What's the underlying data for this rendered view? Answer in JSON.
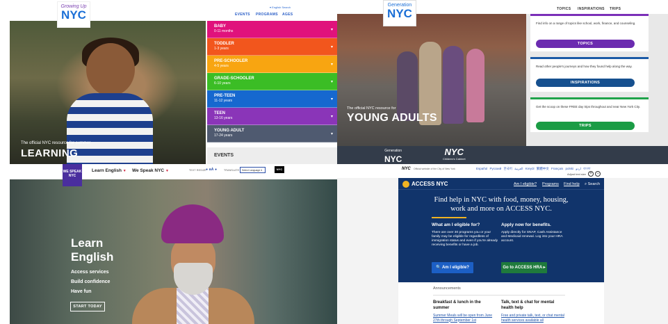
{
  "q1": {
    "logo_small": "Growing Up",
    "logo_big": "NYC",
    "lang_links": "▾ English   Search",
    "nav": [
      "EVENTS",
      "PROGRAMS",
      "AGES"
    ],
    "caption_small": "The official NYC resource for summer",
    "caption_big": "LEARNING",
    "menu": [
      {
        "name": "BABY",
        "sub": "0-11 months",
        "color": "#e0127c"
      },
      {
        "name": "TODDLER",
        "sub": "1-3 years",
        "color": "#f2561d"
      },
      {
        "name": "PRE-SCHOOLER",
        "sub": "4-5 years",
        "color": "#f8a511"
      },
      {
        "name": "GRADE-SCHOOLER",
        "sub": "6-10 years",
        "color": "#3bbd25"
      },
      {
        "name": "PRE-TEEN",
        "sub": "11-12 years",
        "color": "#1668cf"
      },
      {
        "name": "TEEN",
        "sub": "13-16 years",
        "color": "#8a35b8"
      },
      {
        "name": "YOUNG ADULT",
        "sub": "17-24 years",
        "color": "#4f5a70"
      }
    ],
    "events_label": "EVENTS"
  },
  "q2": {
    "logo_small": "Generation",
    "logo_big": "NYC",
    "nav": [
      "TOPICS",
      "INSPIRATIONS",
      "TRIPS"
    ],
    "caption_small": "The official NYC resource for",
    "caption_big": "YOUNG ADULTS",
    "cards": [
      {
        "text": "Find info on a range of topics like school, work, finance, and counseling.",
        "button": "TOPICS",
        "accent": "#7b2fb8",
        "btn_color": "#6b2bb0"
      },
      {
        "text": "Read other people's journeys and how they found help along the way.",
        "button": "INSPIRATIONS",
        "accent": "#1b5aa6",
        "btn_color": "#16508f"
      },
      {
        "text": "Get the scoop on these FREE day trips throughout and near New York City.",
        "button": "TRIPS",
        "accent": "#1fa34a",
        "btn_color": "#1b9c45"
      }
    ],
    "footer_gen_small": "Generation",
    "footer_gen_big": "NYC",
    "footer_nyc_big": "NYC",
    "footer_nyc_small": "Children's Cabinet"
  },
  "q3": {
    "logo_text": "WE SPEAK NYC",
    "menu": [
      "Learn English",
      "We Speak NYC"
    ],
    "text_resize": "TEXT RESIZE",
    "text_size_glyphs": "● aA ●",
    "translate": "TRANSLATE",
    "select_language": "Select Language ▾",
    "nyc_badge": "NYC",
    "heading": "Learn English",
    "links": [
      "Access services",
      "Build confidence",
      "Have fun"
    ],
    "start_today": "START TODAY"
  },
  "q4": {
    "gov_nyc": "NYC",
    "gov_text": "Official website of the City of New York",
    "languages": "Español  Русский  한국어  العربية  Kreyòl  繁體中文  Français  polski  اردو  বাংলা",
    "adjust_text": "Adjust text size",
    "brand": "ACCESS NYC",
    "header_links": [
      "Am I eligible?",
      "Programs",
      "Find help"
    ],
    "search": "⌕ Search",
    "hero": "Find help in NYC with food, money, housing, work and more on ACCESS NYC.",
    "col1_title": "What am I eligible for?",
    "col1_text": "There are over 30 programs you or your family may be eligible for regardless of immigration status and even if you're already receiving benefits or have a job.",
    "col2_title": "Apply now for benefits.",
    "col2_text": "Apply directly for SNAP, Cash Assistance and Medicaid renewal. Log into your HRA account.",
    "btn_eligible": "🔍 Am I eligible?",
    "btn_hra": "Go to ACCESS HRA ▸",
    "announcements": "Announcements",
    "ann1_title": "Breakfast & lunch in the summer",
    "ann1_text": "Summer Meals will be open from June 27th through September 1st",
    "ann2_title": "Talk, text & chat for mental health help",
    "ann2_text": "Free and private talk, text, or chat mental health services available all"
  }
}
